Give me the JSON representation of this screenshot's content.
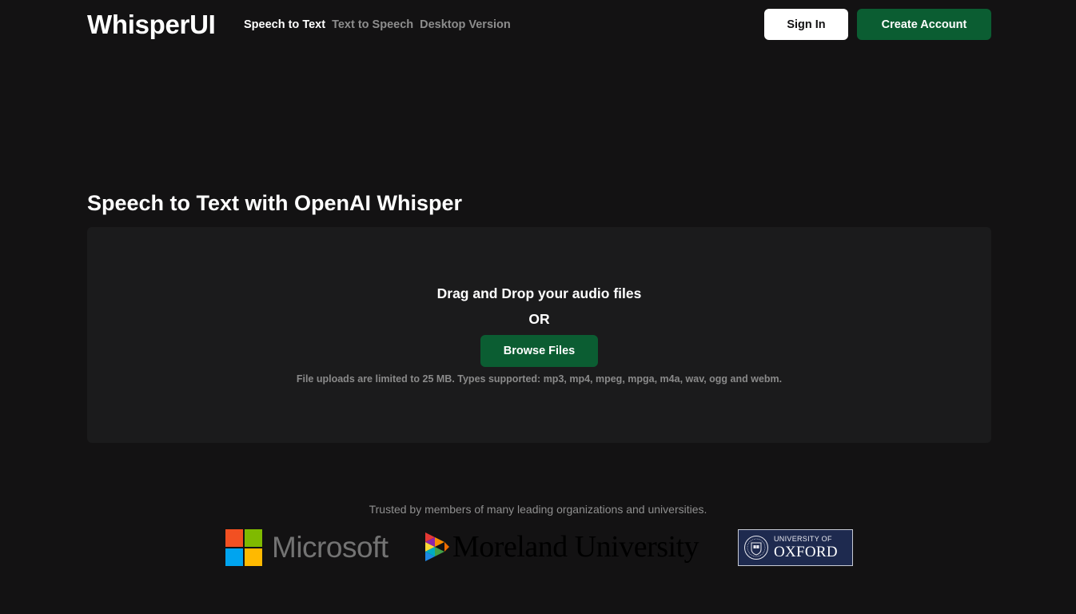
{
  "header": {
    "logo": "WhisperUI",
    "nav": [
      {
        "label": "Speech to Text",
        "active": true
      },
      {
        "label": "Text to Speech",
        "active": false
      },
      {
        "label": "Desktop Version",
        "active": false
      }
    ],
    "sign_in_label": "Sign In",
    "create_account_label": "Create Account"
  },
  "main": {
    "title": "Speech to Text with OpenAI Whisper",
    "dropzone": {
      "title": "Drag and Drop your audio files",
      "or_label": "OR",
      "browse_label": "Browse Files",
      "note": "File uploads are limited to 25 MB. Types supported: mp3, mp4, mpeg, mpga, m4a, wav, ogg and webm."
    }
  },
  "trusted": {
    "text": "Trusted by members of many leading organizations and universities.",
    "logos": [
      {
        "name": "Microsoft",
        "icon": "microsoft-logo"
      },
      {
        "name": "Moreland University",
        "icon": "moreland-university-logo"
      },
      {
        "name": "University of Oxford",
        "small_text": "UNIVERSITY OF",
        "big_text": "OXFORD",
        "icon": "oxford-crest"
      }
    ]
  },
  "colors": {
    "background": "#131213",
    "panel": "#1b1b1c",
    "accent_green": "#0b5d32",
    "muted_text": "#8d8d8d"
  }
}
